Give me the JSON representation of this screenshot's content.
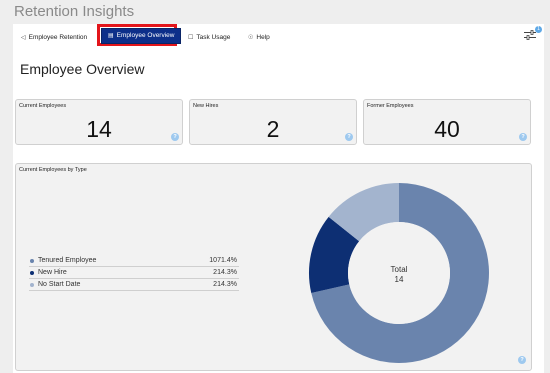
{
  "app": {
    "title": "Retention Insights"
  },
  "nav": {
    "tabs": [
      {
        "label": "Employee Retention",
        "icon": "retention-icon",
        "active": false
      },
      {
        "label": "Employee Overview",
        "icon": "overview-icon",
        "active": true
      },
      {
        "label": "Task Usage",
        "icon": "task-icon",
        "active": false
      },
      {
        "label": "Help",
        "icon": "help-icon",
        "active": false
      }
    ],
    "filter": {
      "icon": "filter-icon",
      "badge": "1"
    }
  },
  "page": {
    "title": "Employee Overview"
  },
  "kpis": [
    {
      "label": "Current Employees",
      "value": "14"
    },
    {
      "label": "New Hires",
      "value": "2"
    },
    {
      "label": "Former Employees",
      "value": "40"
    }
  ],
  "info_glyph": "?",
  "chart_panel": {
    "title": "Current Employees by Type"
  },
  "chart_data": {
    "type": "pie",
    "donut": true,
    "title": "Current Employees by Type",
    "center_label": "Total",
    "center_value": "14",
    "series": [
      {
        "name": "Tenured Employee",
        "value": 10,
        "percent": "71.4%",
        "color": "#6a84ad"
      },
      {
        "name": "New Hire",
        "value": 2,
        "percent": "14.3%",
        "color": "#0d2f73"
      },
      {
        "name": "No Start Date",
        "value": 2,
        "percent": "14.3%",
        "color": "#a3b4ce"
      }
    ],
    "legend_position": "left"
  },
  "colors": {
    "accent": "#0d2f8a",
    "highlight": "#e3151b",
    "info": "#9ec9ef"
  }
}
